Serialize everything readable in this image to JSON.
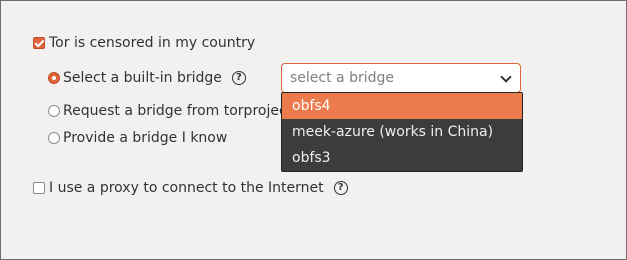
{
  "censored_checkbox": {
    "label": "Tor is censored in my country",
    "checked": true
  },
  "bridge_options": [
    {
      "label": "Select a built-in bridge",
      "selected": true
    },
    {
      "label": "Request a bridge from torproject.o",
      "selected": false
    },
    {
      "label": "Provide a bridge I know",
      "selected": false
    }
  ],
  "bridge_select": {
    "placeholder": "select a bridge",
    "options": [
      "obfs4",
      "meek-azure (works in China)",
      "obfs3"
    ],
    "highlighted": "obfs4"
  },
  "proxy_checkbox": {
    "label": "I use a proxy to connect to the Internet",
    "checked": false
  },
  "help_icon_glyph": "?",
  "icons": {
    "help": "help-circle-icon",
    "dropdown": "chevron-down-icon"
  },
  "colors": {
    "accent": "#e2643a",
    "highlight": "#eb7a4c",
    "menu_bg": "#3c3c3a",
    "window_bg": "#f2f1f0"
  }
}
